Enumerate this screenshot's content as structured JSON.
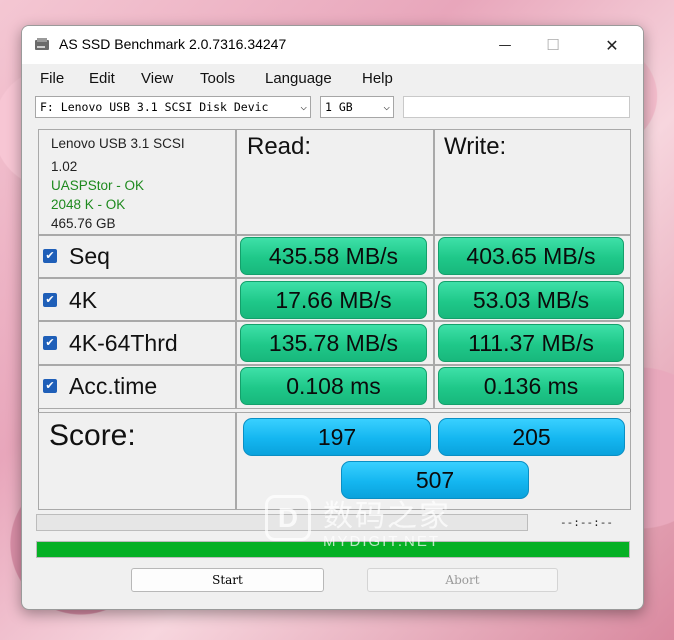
{
  "window": {
    "title": "AS SSD Benchmark 2.0.7316.34247",
    "minimize_glyph": "—",
    "maximize_glyph": "☐",
    "close_glyph": "✕"
  },
  "menu": [
    "File",
    "Edit",
    "View",
    "Tools",
    "Language",
    "Help"
  ],
  "toolbar": {
    "drive_value": "F: Lenovo USB 3.1 SCSI Disk Devic",
    "size_value": "1 GB",
    "extra_field_value": ""
  },
  "device_info": {
    "name": "Lenovo USB 3.1 SCSI",
    "firmware": "1.02",
    "driver_status": "UASPStor - OK",
    "alignment_status": "2048 K - OK",
    "capacity": "465.76 GB"
  },
  "columns": {
    "read": "Read:",
    "write": "Write:"
  },
  "rows": [
    {
      "label": "Seq",
      "checked": true,
      "read": "435.58 MB/s",
      "write": "403.65 MB/s"
    },
    {
      "label": "4K",
      "checked": true,
      "read": "17.66 MB/s",
      "write": "53.03 MB/s"
    },
    {
      "label": "4K-64Thrd",
      "checked": true,
      "read": "135.78 MB/s",
      "write": "111.37 MB/s"
    },
    {
      "label": "Acc.time",
      "checked": true,
      "read": "0.108 ms",
      "write": "0.136 ms"
    }
  ],
  "score": {
    "label": "Score:",
    "read": "197",
    "write": "205",
    "total": "507"
  },
  "progress": {
    "elapsed_text": "--:--:--",
    "overall_fraction": 1.0
  },
  "buttons": {
    "start": "Start",
    "abort": "Abort"
  },
  "watermark": {
    "logo_letter": "D",
    "chinese": "数码之家",
    "english": "MYDIGIT.NET"
  },
  "colors": {
    "result_green": "#1fc889",
    "score_blue": "#14b6f0",
    "progress_green": "#06b025",
    "ok_text": "#1e8a1e",
    "checkbox_blue": "#1f5fb8"
  },
  "icons": {
    "app": "drive-icon",
    "checkbox": "checkmark-icon",
    "dropdown": "chevron-down-icon"
  }
}
